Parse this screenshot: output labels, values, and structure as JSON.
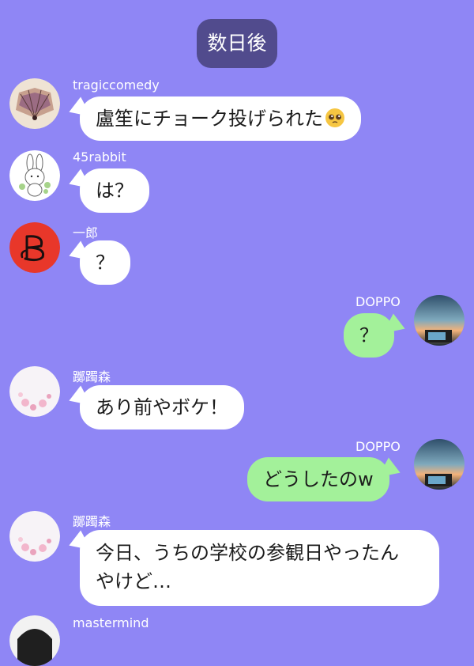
{
  "header": {
    "date_badge": "数日後"
  },
  "messages": [
    {
      "sender": "tragiccomedy",
      "text": "盧笙にチョーク投げられた",
      "emoji": "pleading-face-emoji",
      "side": "left"
    },
    {
      "sender": "45rabbit",
      "text": "は？",
      "side": "left"
    },
    {
      "sender": "一郎",
      "text": "？",
      "side": "left"
    },
    {
      "sender": "DOPPO",
      "text": "？",
      "side": "right"
    },
    {
      "sender": "躑躅森",
      "text": "あり前やボケ！",
      "side": "left"
    },
    {
      "sender": "DOPPO",
      "text": "どうしたのw",
      "side": "right"
    },
    {
      "sender": "躑躅森",
      "text_line1": "今日、うちの学校の参観日やったん",
      "text_line2": "やけど…",
      "side": "left"
    },
    {
      "sender": "mastermind",
      "side": "left"
    }
  ],
  "colors": {
    "background": "#8f86f5",
    "date_badge": "#514b8d",
    "incoming_bubble": "#ffffff",
    "outgoing_bubble": "#a3f19a"
  },
  "icons": {
    "tragiccomedy": "folding-fan-avatar",
    "45rabbit": "rabbit-avatar",
    "ichiro": "letter-b-avatar",
    "doppo": "sunset-camera-avatar",
    "tsutsujimori": "cherry-blossom-avatar",
    "mastermind": "dark-avatar"
  }
}
